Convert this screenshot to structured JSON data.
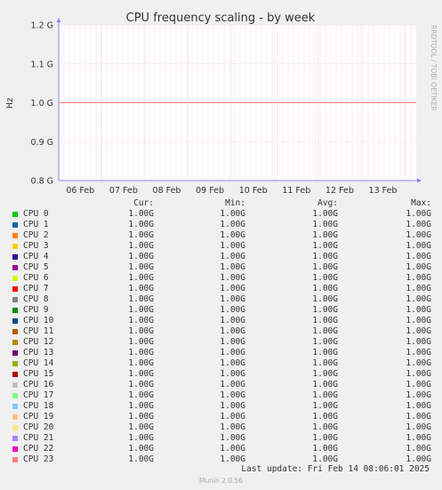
{
  "chart_data": {
    "type": "line",
    "title": "CPU frequency scaling - by week",
    "ylabel": "Hz",
    "ylim": [
      0.8,
      1.2
    ],
    "y_ticks": [
      "0.8 G",
      "0.9 G",
      "1.0 G",
      "1.1 G",
      "1.2 G"
    ],
    "y_tick_values": [
      0.8,
      0.9,
      1.0,
      1.1,
      1.2
    ],
    "x_ticks": [
      "06 Feb",
      "07 Feb",
      "08 Feb",
      "09 Feb",
      "10 Feb",
      "11 Feb",
      "12 Feb",
      "13 Feb"
    ],
    "grid": true,
    "series_value": 1.0,
    "side_label": "RRDTOOL / TOBI OETIKER"
  },
  "legend": {
    "headers": {
      "cur": "Cur:",
      "min": "Min:",
      "avg": "Avg:",
      "max": "Max:"
    },
    "rows": [
      {
        "name": "CPU 0",
        "color": "#00cc00",
        "cur": "1.00G",
        "min": "1.00G",
        "avg": "1.00G",
        "max": "1.00G"
      },
      {
        "name": "CPU 1",
        "color": "#0066b3",
        "cur": "1.00G",
        "min": "1.00G",
        "avg": "1.00G",
        "max": "1.00G"
      },
      {
        "name": "CPU 2",
        "color": "#ff8000",
        "cur": "1.00G",
        "min": "1.00G",
        "avg": "1.00G",
        "max": "1.00G"
      },
      {
        "name": "CPU 3",
        "color": "#ffcc00",
        "cur": "1.00G",
        "min": "1.00G",
        "avg": "1.00G",
        "max": "1.00G"
      },
      {
        "name": "CPU 4",
        "color": "#330099",
        "cur": "1.00G",
        "min": "1.00G",
        "avg": "1.00G",
        "max": "1.00G"
      },
      {
        "name": "CPU 5",
        "color": "#990099",
        "cur": "1.00G",
        "min": "1.00G",
        "avg": "1.00G",
        "max": "1.00G"
      },
      {
        "name": "CPU 6",
        "color": "#ccff00",
        "cur": "1.00G",
        "min": "1.00G",
        "avg": "1.00G",
        "max": "1.00G"
      },
      {
        "name": "CPU 7",
        "color": "#ff0000",
        "cur": "1.00G",
        "min": "1.00G",
        "avg": "1.00G",
        "max": "1.00G"
      },
      {
        "name": "CPU 8",
        "color": "#808080",
        "cur": "1.00G",
        "min": "1.00G",
        "avg": "1.00G",
        "max": "1.00G"
      },
      {
        "name": "CPU 9",
        "color": "#008f00",
        "cur": "1.00G",
        "min": "1.00G",
        "avg": "1.00G",
        "max": "1.00G"
      },
      {
        "name": "CPU 10",
        "color": "#00487d",
        "cur": "1.00G",
        "min": "1.00G",
        "avg": "1.00G",
        "max": "1.00G"
      },
      {
        "name": "CPU 11",
        "color": "#b35a00",
        "cur": "1.00G",
        "min": "1.00G",
        "avg": "1.00G",
        "max": "1.00G"
      },
      {
        "name": "CPU 12",
        "color": "#b38f00",
        "cur": "1.00G",
        "min": "1.00G",
        "avg": "1.00G",
        "max": "1.00G"
      },
      {
        "name": "CPU 13",
        "color": "#6b006b",
        "cur": "1.00G",
        "min": "1.00G",
        "avg": "1.00G",
        "max": "1.00G"
      },
      {
        "name": "CPU 14",
        "color": "#8fb300",
        "cur": "1.00G",
        "min": "1.00G",
        "avg": "1.00G",
        "max": "1.00G"
      },
      {
        "name": "CPU 15",
        "color": "#b30000",
        "cur": "1.00G",
        "min": "1.00G",
        "avg": "1.00G",
        "max": "1.00G"
      },
      {
        "name": "CPU 16",
        "color": "#bebebe",
        "cur": "1.00G",
        "min": "1.00G",
        "avg": "1.00G",
        "max": "1.00G"
      },
      {
        "name": "CPU 17",
        "color": "#80ff80",
        "cur": "1.00G",
        "min": "1.00G",
        "avg": "1.00G",
        "max": "1.00G"
      },
      {
        "name": "CPU 18",
        "color": "#80c9ff",
        "cur": "1.00G",
        "min": "1.00G",
        "avg": "1.00G",
        "max": "1.00G"
      },
      {
        "name": "CPU 19",
        "color": "#ffc080",
        "cur": "1.00G",
        "min": "1.00G",
        "avg": "1.00G",
        "max": "1.00G"
      },
      {
        "name": "CPU 20",
        "color": "#ffe680",
        "cur": "1.00G",
        "min": "1.00G",
        "avg": "1.00G",
        "max": "1.00G"
      },
      {
        "name": "CPU 21",
        "color": "#aa80ff",
        "cur": "1.00G",
        "min": "1.00G",
        "avg": "1.00G",
        "max": "1.00G"
      },
      {
        "name": "CPU 22",
        "color": "#ee00cc",
        "cur": "1.00G",
        "min": "1.00G",
        "avg": "1.00G",
        "max": "1.00G"
      },
      {
        "name": "CPU 23",
        "color": "#ff8080",
        "cur": "1.00G",
        "min": "1.00G",
        "avg": "1.00G",
        "max": "1.00G"
      }
    ]
  },
  "footer": {
    "last_update": "Last update: Fri Feb 14 08:06:01 2025",
    "version": "Munin 2.0.56"
  }
}
